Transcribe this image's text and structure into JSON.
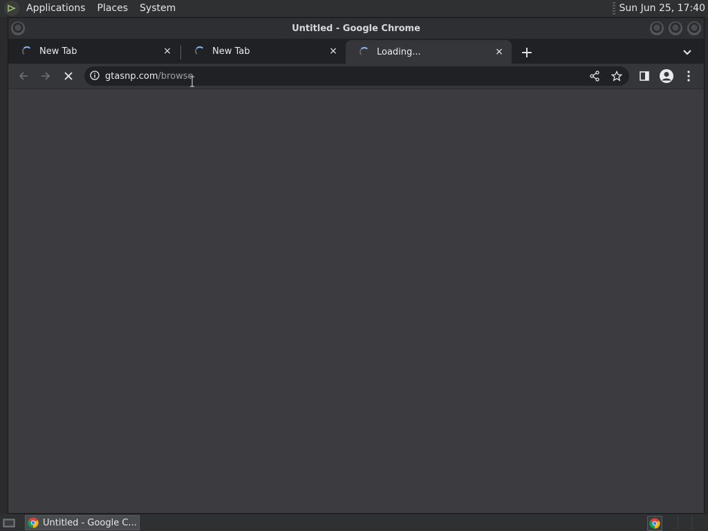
{
  "panel": {
    "menus": [
      "Applications",
      "Places",
      "System"
    ],
    "clock": "Sun Jun 25, 17:40"
  },
  "window": {
    "title": "Untitled - Google Chrome"
  },
  "tabs": [
    {
      "title": "New Tab",
      "close": "×"
    },
    {
      "title": "New Tab",
      "close": "×"
    },
    {
      "title": "Loading...",
      "close": "×"
    }
  ],
  "newtab": "+",
  "omnibox": {
    "host": "gtasnp.com",
    "path": "/browse"
  },
  "taskbar": {
    "task_title": "Untitled - Google C..."
  },
  "colors": {
    "accent": "#8ab4f8",
    "content_bg": "#3c3c40",
    "toolbar_bg": "#35363a"
  }
}
